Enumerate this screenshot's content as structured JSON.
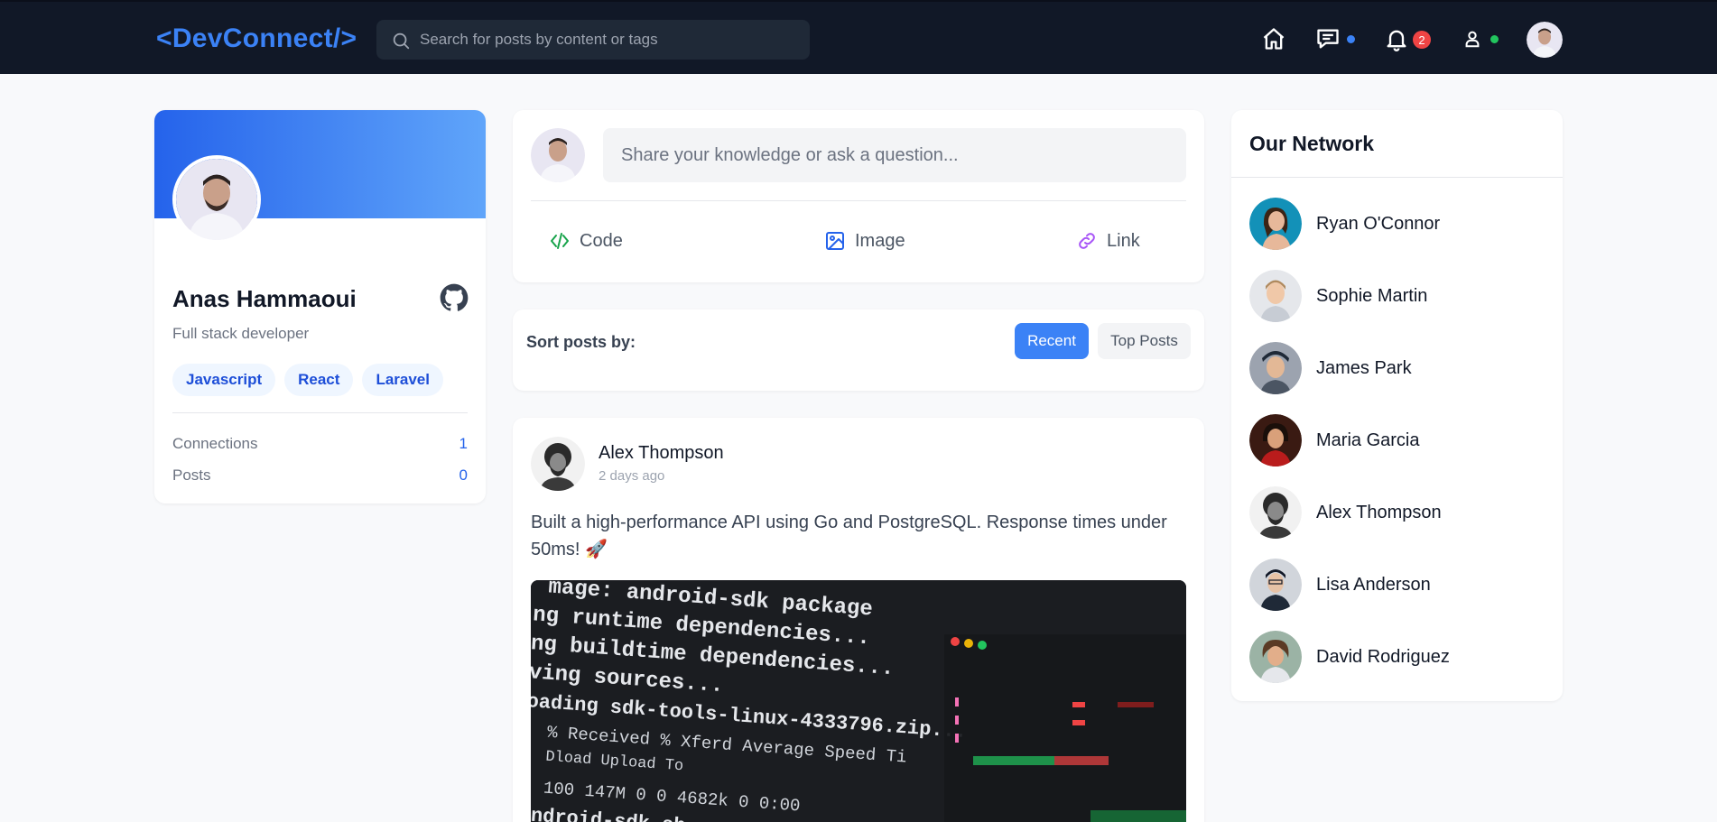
{
  "header": {
    "logo": "<DevConnect/>",
    "search_placeholder": "Search for posts by content or tags",
    "notifications_count": "2",
    "colors": {
      "background": "#111827",
      "accent": "#3b82f6",
      "badge": "#ef4444",
      "online": "#22c55e",
      "message_dot": "#3b82f6"
    }
  },
  "profile": {
    "name": "Anas Hammaoui",
    "title": "Full stack developer",
    "tags": [
      "Javascript",
      "React",
      "Laravel"
    ],
    "stats": [
      {
        "label": "Connections",
        "value": "1"
      },
      {
        "label": "Posts",
        "value": "0"
      }
    ]
  },
  "composer": {
    "placeholder": "Share your knowledge or ask a question...",
    "actions": [
      {
        "label": "Code",
        "icon": "code-icon",
        "color": "#16a34a"
      },
      {
        "label": "Image",
        "icon": "image-icon",
        "color": "#2563eb"
      },
      {
        "label": "Link",
        "icon": "link-icon",
        "color": "#a855f7"
      }
    ]
  },
  "sort": {
    "label": "Sort posts by:",
    "options": [
      "Recent",
      "Top Posts"
    ],
    "selected": "Recent"
  },
  "post": {
    "author": "Alex Thompson",
    "time": "2 days ago",
    "text": "Built a high-performance API using Go and PostgreSQL. Response times under 50ms! 🚀",
    "image_lines": [
      "mage: android-sdk package",
      "ng runtime dependencies...",
      "ng buildtime dependencies...",
      "ving sources...",
      "oading sdk-tools-linux-4333796.zip...",
      "  % Received % Xferd  Average Speed  Ti",
      "                      Dload  Upload  To",
      "100  147M    0     0  4682k      0 0:00",
      "android-sdk.sh"
    ]
  },
  "network": {
    "title": "Our Network",
    "members": [
      {
        "name": "Ryan O'Connor"
      },
      {
        "name": "Sophie Martin"
      },
      {
        "name": "James Park"
      },
      {
        "name": "Maria Garcia"
      },
      {
        "name": "Alex Thompson"
      },
      {
        "name": "Lisa Anderson"
      },
      {
        "name": "David Rodriguez"
      }
    ]
  }
}
